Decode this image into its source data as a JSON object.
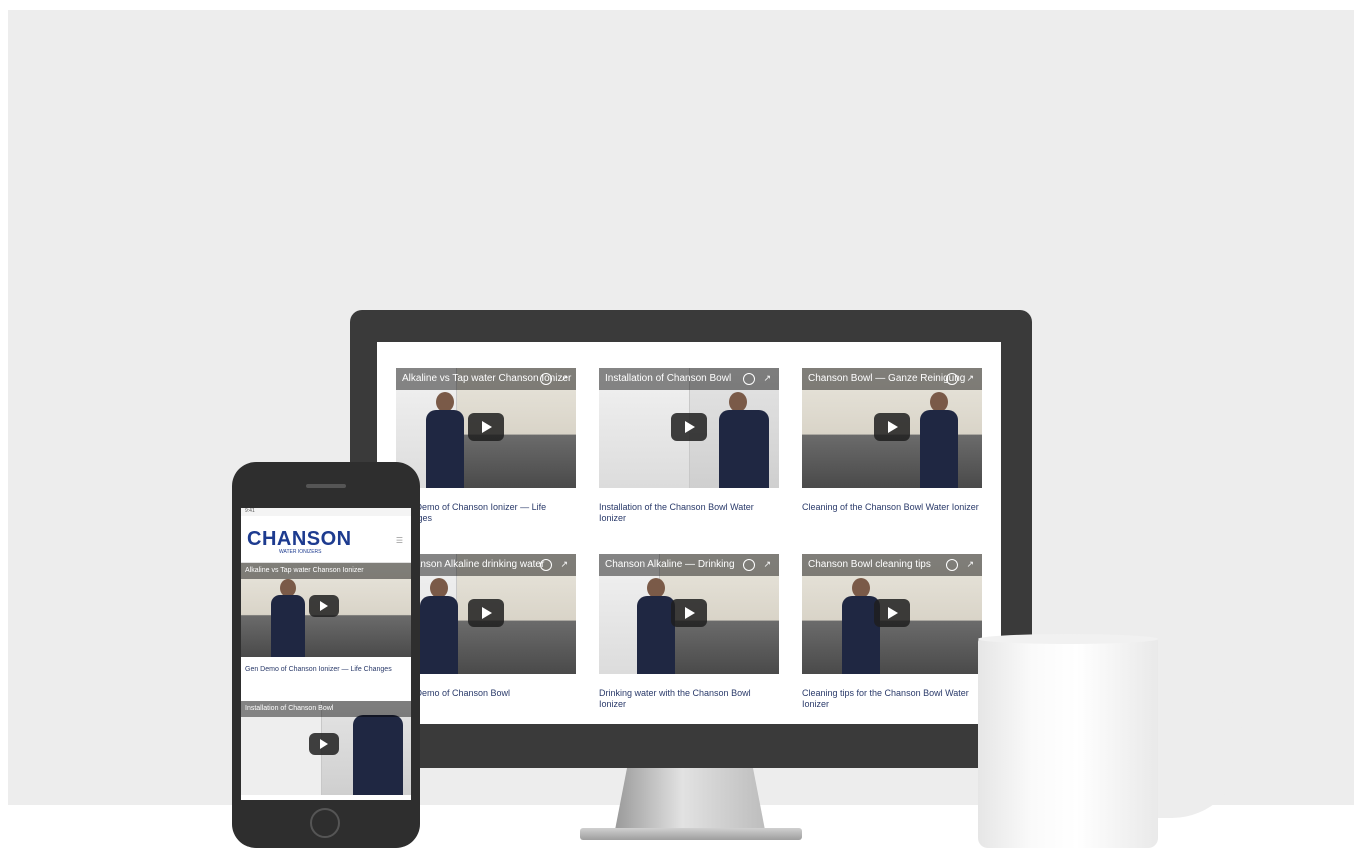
{
  "monitor": {
    "videos": [
      {
        "title": "Alkaline vs Tap water Chanson Ionizer",
        "caption": "Gen Demo of Chanson Ionizer — Life Changes"
      },
      {
        "title": "Installation of Chanson Bowl",
        "caption": "Installation of the Chanson Bowl Water Ionizer"
      },
      {
        "title": "Chanson Bowl — Ganze Reinigung",
        "caption": "Cleaning of the Chanson Bowl Water Ionizer"
      },
      {
        "title": "Chanson Alkaline drinking water",
        "caption": "Gen Demo of Chanson Bowl"
      },
      {
        "title": "Chanson Alkaline — Drinking",
        "caption": "Drinking water with the Chanson Bowl Ionizer"
      },
      {
        "title": "Chanson Bowl cleaning tips",
        "caption": "Cleaning tips for the Chanson Bowl Water Ionizer"
      }
    ]
  },
  "phone": {
    "status": "9:41",
    "logo": "CHANSON",
    "logo_sub": "WATER IONIZERS",
    "menu": "☰",
    "videos": [
      {
        "title": "Alkaline vs Tap water Chanson Ionizer",
        "caption": "Gen Demo of Chanson Ionizer — Life Changes"
      },
      {
        "title": "Installation of Chanson Bowl",
        "caption": ""
      }
    ]
  },
  "colors": {
    "brand": "#1d3b8f",
    "bezel": "#3a3a3a",
    "backdrop": "#ededed"
  },
  "icons": [
    "play-icon",
    "clock-icon",
    "share-icon",
    "menu-icon"
  ]
}
